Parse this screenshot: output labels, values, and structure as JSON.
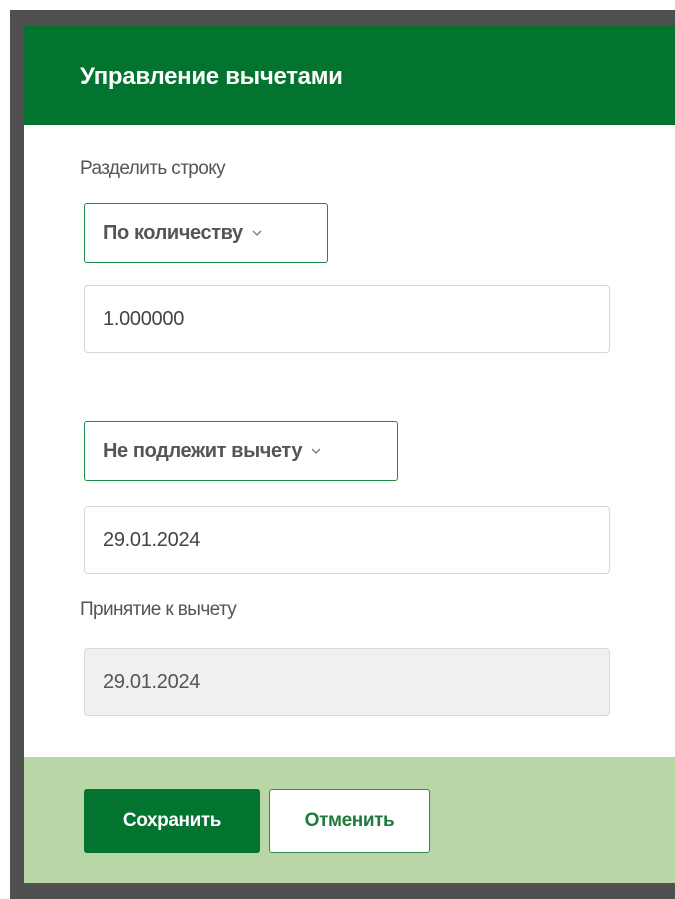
{
  "dialog": {
    "title": "Управление вычетами",
    "split_label": "Разделить строку",
    "split_mode": {
      "selected": "По количеству"
    },
    "quantity_value": "1.000000",
    "deduction_mode": {
      "selected": "Не подлежит вычету"
    },
    "date_value": "29.01.2024",
    "acceptance_label": "Принятие к вычету",
    "acceptance_date_value": "29.01.2024"
  },
  "footer": {
    "save_label": "Сохранить",
    "cancel_label": "Отменить"
  },
  "colors": {
    "header_bg": "#037430",
    "footer_bg": "#b9d6a6",
    "accent_border": "#1f8a48",
    "backdrop": "#505050"
  },
  "icons": {
    "dropdown_chevron": "chevron-down-icon"
  }
}
